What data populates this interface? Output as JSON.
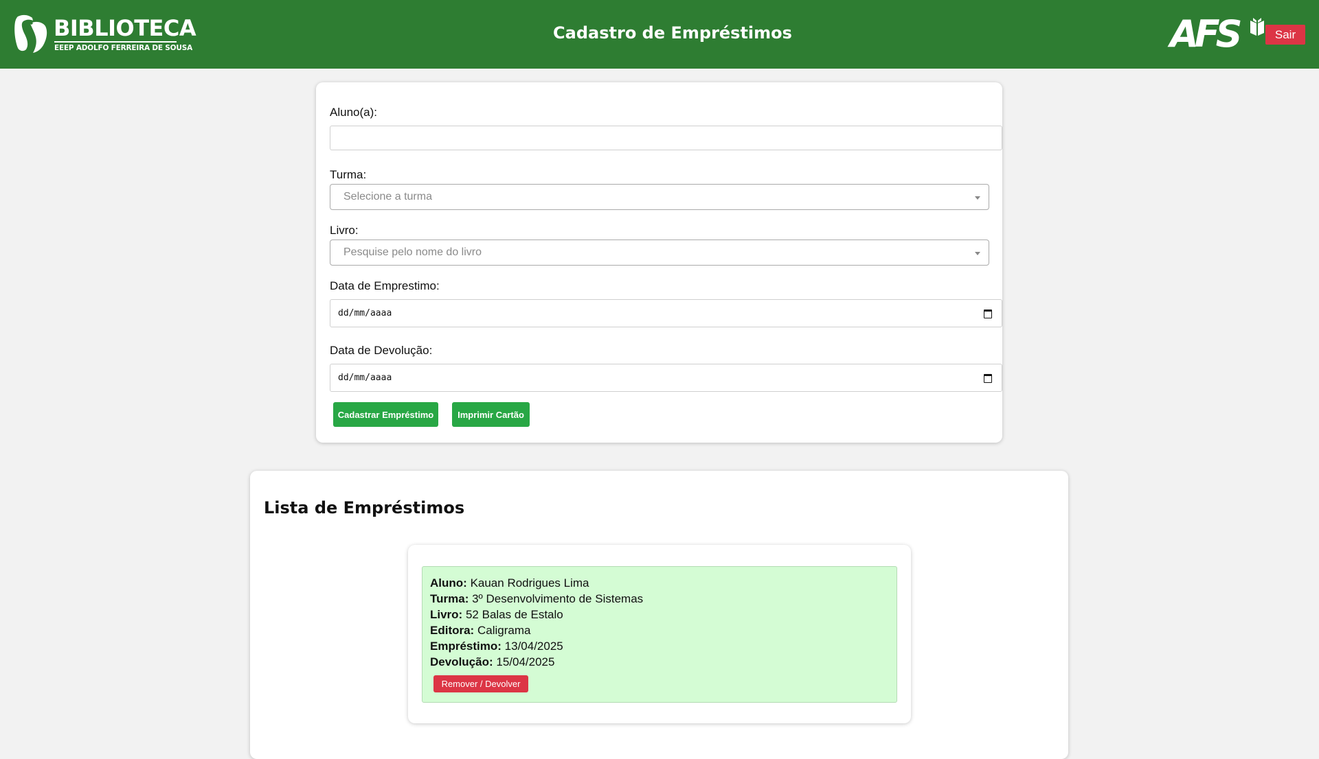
{
  "header": {
    "brand_title": "BIBLIOTECA",
    "brand_subtitle": "EEEP ADOLFO FERREIRA DE SOUSA",
    "page_title": "Cadastro de Empréstimos",
    "partner_logo_text": "AFS",
    "logout_label": "Sair",
    "background_color": "#2e7d32"
  },
  "form": {
    "student_label": "Aluno(a):",
    "student_value": "",
    "class_label": "Turma:",
    "class_placeholder": "Selecione a turma",
    "book_label": "Livro:",
    "book_placeholder": "Pesquise pelo nome do livro",
    "loan_date_label": "Data de Emprestimo:",
    "loan_date_placeholder": "dd/mm/aaaa",
    "return_date_label": "Data de Devolução:",
    "return_date_placeholder": "dd/mm/aaaa",
    "submit_label": "Cadastrar Empréstimo",
    "print_label": "Imprimir Cartão"
  },
  "loans": {
    "title": "Lista de Empréstimos",
    "items": [
      {
        "student_key": "Aluno:",
        "student": "Kauan Rodrigues Lima",
        "class_key": "Turma:",
        "class": "3º Desenvolvimento de Sistemas",
        "book_key": "Livro:",
        "book": "52 Balas de Estalo",
        "publisher_key": "Editora:",
        "publisher": "Caligrama",
        "loan_key": "Empréstimo:",
        "loan_date": "13/04/2025",
        "return_key": "Devolução:",
        "return_date": "15/04/2025",
        "remove_label": "Remover / Devolver"
      }
    ]
  },
  "colors": {
    "primary_green": "#2e7d32",
    "button_green": "#28a745",
    "danger_red": "#dc3545",
    "loan_item_bg": "#d4fcd4"
  },
  "icons": [
    "biblioteca-logo-icon",
    "afs-logo-icon",
    "book-icon",
    "dropdown-arrow-icon",
    "calendar-icon"
  ]
}
